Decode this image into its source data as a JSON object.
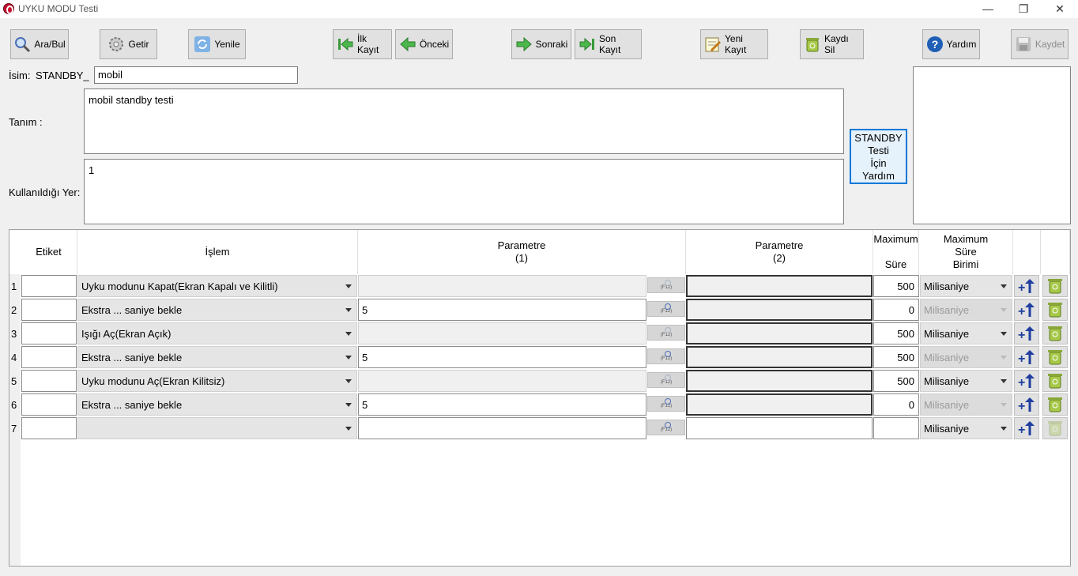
{
  "window": {
    "title": "UYKU MODU Testi",
    "minimize": "—",
    "restore": "❐",
    "close": "✕"
  },
  "toolbar": {
    "search": "Ara/Bul",
    "fetch": "Getir",
    "refresh": "Yenile",
    "first": "İlk Kayıt",
    "prev": "Önceki",
    "next": "Sonraki",
    "last": "Son Kayıt",
    "new": "Yeni Kayıt",
    "delete": "Kaydı Sil",
    "help": "Yardım",
    "save": "Kaydet"
  },
  "form": {
    "name_label": "İsim:",
    "name_prefix": "STANDBY_",
    "name_value": "mobil",
    "desc_label": "Tanım :",
    "desc_value": "mobil standby testi",
    "usage_label": "Kullanıldığı Yer:",
    "usage_value": "1",
    "help_button": "STANDBY\nTesti\nİçin\nYardım"
  },
  "grid": {
    "headers": {
      "label": "Etiket",
      "operation": "İşlem",
      "param1": "Parametre\n(1)",
      "param2": "Parametre\n(2)",
      "maxtime": "Maximum\n\nSüre",
      "maxunit": "Maximum\nSüre\nBirimi"
    },
    "rows": [
      {
        "num": "1",
        "label": "",
        "operation": "Uyku modunu Kapat(Ekran Kapalı ve Kilitli)",
        "param1": "",
        "param2": "",
        "maxtime": "500",
        "unit": "Milisaniye"
      },
      {
        "num": "2",
        "label": "",
        "operation": "Ekstra ... saniye bekle",
        "param1": "5",
        "param2": "",
        "maxtime": "0",
        "unit": "Milisaniye"
      },
      {
        "num": "3",
        "label": "",
        "operation": "Işığı Aç(Ekran Açık)",
        "param1": "",
        "param2": "",
        "maxtime": "500",
        "unit": "Milisaniye"
      },
      {
        "num": "4",
        "label": "",
        "operation": "Ekstra ... saniye bekle",
        "param1": "5",
        "param2": "",
        "maxtime": "500",
        "unit": "Milisaniye"
      },
      {
        "num": "5",
        "label": "",
        "operation": "Uyku modunu Aç(Ekran Kilitsiz)",
        "param1": "",
        "param2": "",
        "maxtime": "500",
        "unit": "Milisaniye"
      },
      {
        "num": "6",
        "label": "",
        "operation": "Ekstra ... saniye bekle",
        "param1": "5",
        "param2": "",
        "maxtime": "0",
        "unit": "Milisaniye"
      },
      {
        "num": "7",
        "label": "",
        "operation": "",
        "param1": "",
        "param2": "",
        "maxtime": "",
        "unit": "Milisaniye"
      }
    ],
    "search_button_text": "(F12)"
  }
}
